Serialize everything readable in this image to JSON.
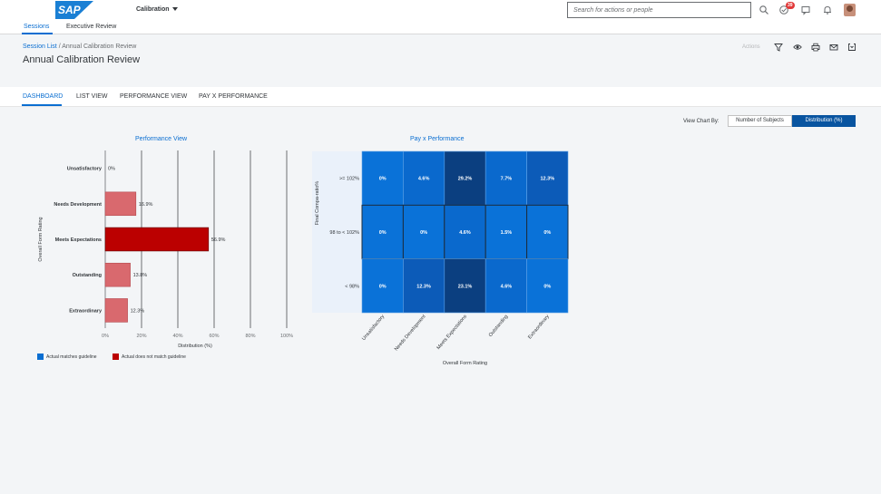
{
  "shell": {
    "logo_text": "SAP",
    "app_title": "Calibration",
    "search_placeholder": "Search for actions or people",
    "notifications_count": "39",
    "tabs": [
      {
        "label": "Sessions"
      },
      {
        "label": "Executive Review"
      }
    ]
  },
  "header": {
    "breadcrumb_link": "Session List",
    "breadcrumb_sep": " / ",
    "breadcrumb_current": "Annual Calibration Review",
    "title": "Annual Calibration Review",
    "actions_label": "Actions"
  },
  "tabs": [
    {
      "label": "DASHBOARD"
    },
    {
      "label": "LIST VIEW"
    },
    {
      "label": "PERFORMANCE VIEW"
    },
    {
      "label": "PAY X PERFORMANCE"
    }
  ],
  "view_chart": {
    "label": "View Chart By:",
    "options": [
      "Number of Subjects",
      "Distribution (%)"
    ],
    "selected": "Distribution (%)"
  },
  "colors": {
    "accent": "#0a6ed1",
    "bar_fill": "#d9696e",
    "bar_fill_strong": "#bb0000",
    "matches_guideline": "#0a6ed1",
    "not_match_guideline": "#bb0000"
  },
  "legend": {
    "matches": "Actual matches guideline",
    "not_match": "Actual does not match guideline"
  },
  "chart_data": [
    {
      "type": "bar",
      "orientation": "horizontal",
      "title": "Performance View",
      "xlabel": "Distribution (%)",
      "ylabel": "Overall Form Rating",
      "xlim": [
        0,
        100
      ],
      "x_ticks": [
        "0%",
        "20%",
        "40%",
        "60%",
        "80%",
        "100%"
      ],
      "grid": true,
      "categories": [
        "Unsatisfactory",
        "Needs Development",
        "Meets Expectations",
        "Outstanding",
        "Extraordinary"
      ],
      "values": [
        0,
        16.9,
        56.9,
        13.8,
        12.3
      ],
      "value_labels": [
        "0%",
        "16.9%",
        "56.9%",
        "13.8%",
        "12.3%"
      ],
      "emphasized": [
        false,
        false,
        true,
        false,
        false
      ]
    },
    {
      "type": "heatmap",
      "title": "Pay x Performance",
      "xlabel": "Overall Form Rating",
      "ylabel": "Final Compa-ratio%",
      "x_categories": [
        "Unsatisfactory",
        "Needs Development",
        "Meets Expectations",
        "Outstanding",
        "Extraordinary"
      ],
      "y_categories": [
        ">= 102%",
        "98 to < 102%",
        "< 98%"
      ],
      "values": [
        [
          0,
          4.6,
          29.2,
          7.7,
          12.3
        ],
        [
          0,
          0,
          4.6,
          1.5,
          0
        ],
        [
          0,
          12.3,
          23.1,
          4.6,
          0
        ]
      ],
      "value_labels": [
        [
          "0%",
          "4.6%",
          "29.2%",
          "7.7%",
          "12.3%"
        ],
        [
          "0%",
          "0%",
          "4.6%",
          "1.5%",
          "0%"
        ],
        [
          "0%",
          "12.3%",
          "23.1%",
          "4.6%",
          "0%"
        ]
      ]
    }
  ]
}
